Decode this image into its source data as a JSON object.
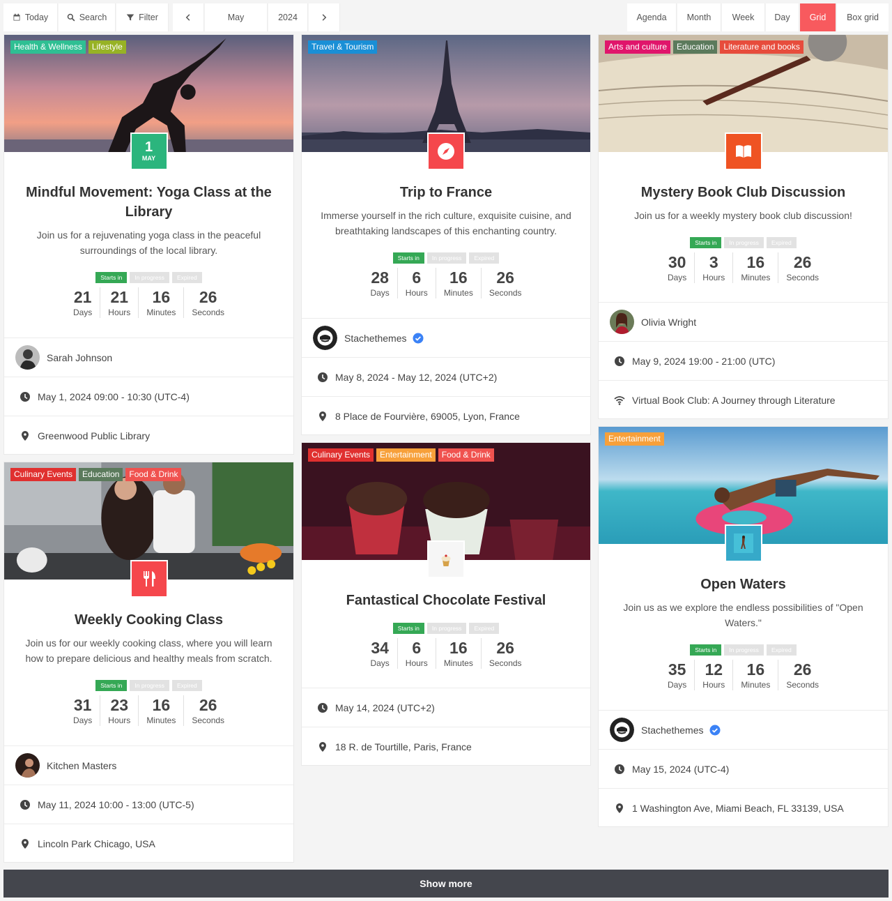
{
  "toolbar": {
    "today": "Today",
    "search": "Search",
    "filter": "Filter",
    "month": "May",
    "year": "2024",
    "views": [
      "Agenda",
      "Month",
      "Week",
      "Day",
      "Grid",
      "Box grid"
    ],
    "active_view": "Grid"
  },
  "states": {
    "starts": "Starts in",
    "progress": "In progress",
    "expired": "Expired"
  },
  "units": {
    "days": "Days",
    "hours": "Hours",
    "minutes": "Minutes",
    "seconds": "Seconds"
  },
  "events": [
    {
      "tags": [
        {
          "label": "Health & Wellness",
          "color": "#2fbf93"
        },
        {
          "label": "Lifestyle",
          "color": "#97b225"
        }
      ],
      "badge_day": "1",
      "badge_month": "MAY",
      "badge_color": "#2bb57d",
      "title_line1": "Mindful Movement: Yoga Class at the",
      "title_line2": "Library",
      "desc_line1": "Join us for a rejuvenating yoga class in the peaceful",
      "desc_line2": "surroundings of the local library.",
      "countdown": {
        "days": "21",
        "hours": "21",
        "minutes": "16",
        "seconds": "26"
      },
      "organizer": "Sarah Johnson",
      "datetime": "May 1, 2024 09:00 - 10:30 (UTC-4)",
      "location": "Greenwood Public Library"
    },
    {
      "tags": [
        {
          "label": "Travel & Tourism",
          "color": "#1a8fd6"
        }
      ],
      "badge_icon": "compass-icon",
      "badge_color": "#f5474c",
      "title": "Trip to France",
      "desc_line1": "Immerse yourself in the rich culture, exquisite cuisine, and",
      "desc_line2": "breathtaking landscapes of this enchanting country.",
      "countdown": {
        "days": "28",
        "hours": "6",
        "minutes": "16",
        "seconds": "26"
      },
      "organizer": "Stachethemes",
      "datetime": "May 8, 2024 - May 12, 2024 (UTC+2)",
      "location": "8 Place de Fourvière, 69005, Lyon, France"
    },
    {
      "tags": [
        {
          "label": "Arts and culture",
          "color": "#e0156b"
        },
        {
          "label": "Education",
          "color": "#5b7a5c"
        },
        {
          "label": "Literature and books",
          "color": "#e74c3c"
        }
      ],
      "badge_icon": "book-icon",
      "badge_color": "#ef5323",
      "title": "Mystery Book Club Discussion",
      "desc": "Join us for a weekly mystery book club discussion!",
      "countdown": {
        "days": "30",
        "hours": "3",
        "minutes": "16",
        "seconds": "26"
      },
      "organizer": "Olivia Wright",
      "datetime": "May 9, 2024 19:00 - 21:00 (UTC)",
      "location": "Virtual Book Club: A Journey through Literature"
    },
    {
      "tags": [
        {
          "label": "Culinary Events",
          "color": "#e0302f"
        },
        {
          "label": "Education",
          "color": "#5b7a5c"
        },
        {
          "label": "Food & Drink",
          "color": "#f0524f"
        }
      ],
      "badge_icon": "utensils-icon",
      "badge_color": "#f5474c",
      "title": "Weekly Cooking Class",
      "desc_line1": "Join us for our weekly cooking class, where you will learn",
      "desc_line2": "how to prepare delicious and healthy meals from scratch.",
      "countdown": {
        "days": "31",
        "hours": "23",
        "minutes": "16",
        "seconds": "26"
      },
      "organizer": "Kitchen Masters",
      "datetime": "May 11, 2024 10:00 - 13:00 (UTC-5)",
      "location": "Lincoln Park Chicago, USA"
    },
    {
      "tags": [
        {
          "label": "Culinary Events",
          "color": "#e0302f"
        },
        {
          "label": "Entertainment",
          "color": "#f7a03a"
        },
        {
          "label": "Food & Drink",
          "color": "#f0524f"
        }
      ],
      "badge_icon": "cupcake-image",
      "title": "Fantastical Chocolate Festival",
      "countdown": {
        "days": "34",
        "hours": "6",
        "minutes": "16",
        "seconds": "26"
      },
      "datetime": "May 14, 2024 (UTC+2)",
      "location": "18 R. de Tourtille, Paris, France"
    },
    {
      "tags": [
        {
          "label": "Entertainment",
          "color": "#f7a03a"
        }
      ],
      "badge_icon": "swimmer-image",
      "title": "Open Waters",
      "desc_line1": "Join us as we explore the endless possibilities of \"Open",
      "desc_line2": "Waters.\"",
      "countdown": {
        "days": "35",
        "hours": "12",
        "minutes": "16",
        "seconds": "26"
      },
      "organizer": "Stachethemes",
      "datetime": "May 15, 2024 (UTC-4)",
      "location": "1 Washington Ave, Miami Beach, FL 33139, USA"
    }
  ],
  "show_more": "Show more"
}
